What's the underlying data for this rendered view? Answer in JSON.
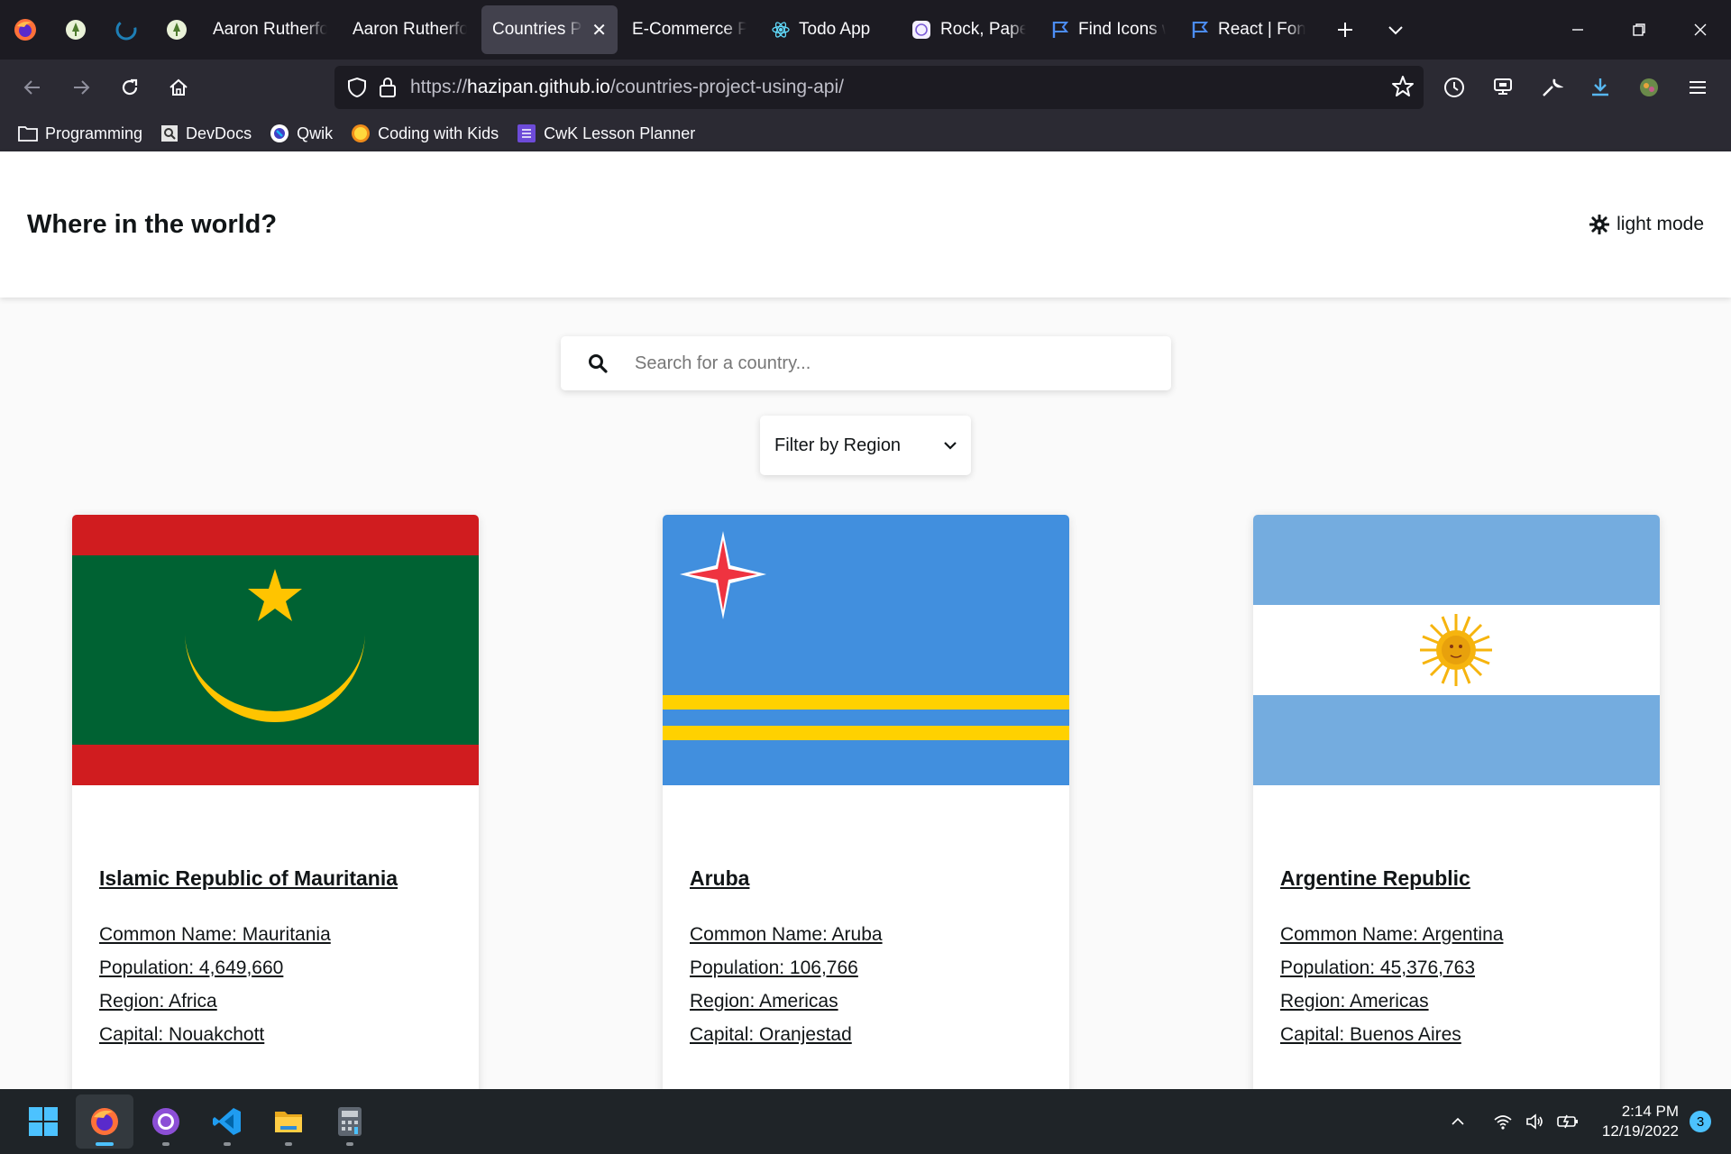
{
  "browser": {
    "tabs": [
      {
        "label": "Aaron Rutherford",
        "icon": "page-icon",
        "active": false
      },
      {
        "label": "Aaron Rutherford",
        "icon": "page-icon",
        "active": false
      },
      {
        "label": "Countries Project",
        "icon": "none",
        "active": true
      },
      {
        "label": "E-Commerce Page",
        "icon": "none",
        "active": false
      },
      {
        "label": "Todo App",
        "icon": "react-icon",
        "active": false
      },
      {
        "label": "Rock, Paper, Scissors",
        "icon": "game-icon",
        "active": false
      },
      {
        "label": "Find Icons with",
        "icon": "flag-icon",
        "active": false
      },
      {
        "label": "React | Font",
        "icon": "flag-icon",
        "active": false
      }
    ],
    "url_prefix": "https://",
    "url_host": "hazipan.github.io",
    "url_path": "/countries-project-using-api/",
    "bookmarks": [
      {
        "label": "Programming",
        "icon": "folder-icon"
      },
      {
        "label": "DevDocs",
        "icon": "devdocs-icon"
      },
      {
        "label": "Qwik",
        "icon": "qwik-icon"
      },
      {
        "label": "Coding with Kids",
        "icon": "cwk-icon"
      },
      {
        "label": "CwK Lesson Planner",
        "icon": "list-icon"
      }
    ]
  },
  "page": {
    "title": "Where in the world?",
    "mode_label": "light mode",
    "search_placeholder": "Search for a country...",
    "filter_label": "Filter by Region"
  },
  "countries": [
    {
      "official": "Islamic Republic of Mauritania",
      "common": "Common Name: Mauritania",
      "population": "Population: 4,649,660",
      "region": "Region: Africa",
      "capital": "Capital: Nouakchott",
      "flag": "mauritania-flag"
    },
    {
      "official": "Aruba",
      "common": "Common Name: Aruba",
      "population": "Population: 106,766",
      "region": "Region: Americas",
      "capital": "Capital: Oranjestad",
      "flag": "aruba-flag"
    },
    {
      "official": "Argentine Republic",
      "common": "Common Name: Argentina",
      "population": "Population: 45,376,763",
      "region": "Region: Americas",
      "capital": "Capital: Buenos Aires",
      "flag": "argentina-flag"
    }
  ],
  "taskbar": {
    "apps": [
      "windows-start",
      "firefox",
      "github-desktop",
      "vscode",
      "file-explorer",
      "calculator"
    ],
    "time": "2:14 PM",
    "date": "12/19/2022",
    "notifications": "3"
  }
}
